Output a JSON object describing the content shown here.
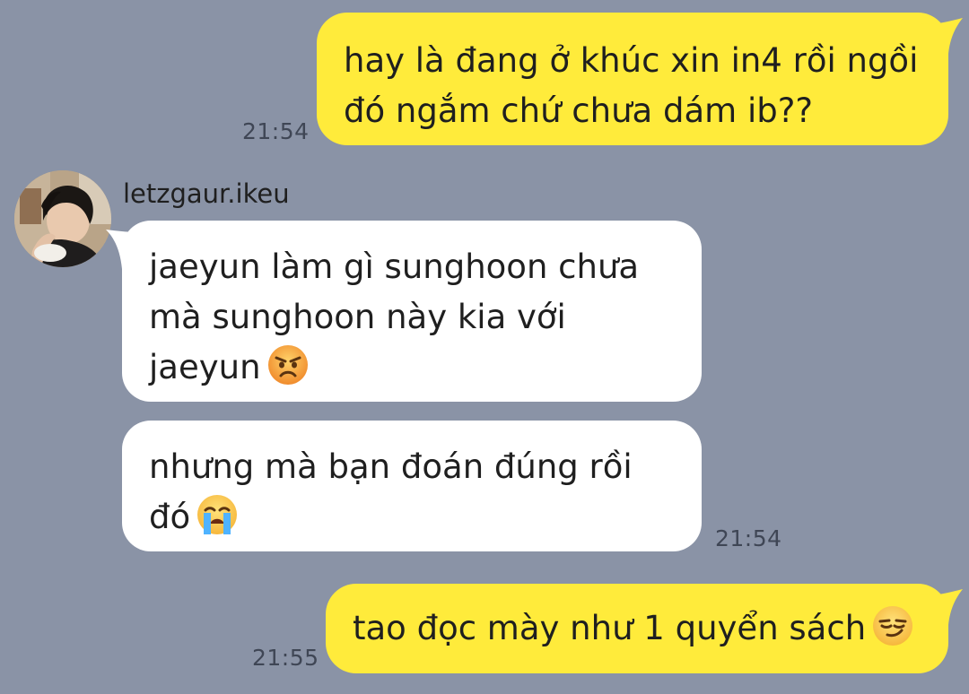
{
  "chat": {
    "messages": [
      {
        "id": "m1",
        "direction": "outgoing",
        "lines": [
          "hay là đang ở khúc xin in4 rồi ngồi",
          "đó ngắm chứ chưa dám ib??"
        ],
        "time": "21:54"
      },
      {
        "id": "m2",
        "direction": "incoming",
        "sender": "letzgaur.ikeu",
        "lines": [
          "jaeyun làm gì sunghoon chưa",
          "mà sunghoon này kia với",
          "jaeyun"
        ],
        "emoji": "angry-face-emoji"
      },
      {
        "id": "m3",
        "direction": "incoming",
        "lines": [
          "nhưng mà bạn đoán đúng rồi",
          "đó"
        ],
        "emoji": "loudly-crying-face-emoji",
        "time": "21:54"
      },
      {
        "id": "m4",
        "direction": "outgoing",
        "lines": [
          "tao đọc mày như 1 quyển sách"
        ],
        "emoji": "smirking-face-emoji",
        "time": "21:55"
      }
    ]
  },
  "colors": {
    "background": "#8a93a6",
    "outgoing_bubble": "#ffeb3b",
    "incoming_bubble": "#ffffff",
    "timestamp_text": "#3f4655"
  }
}
